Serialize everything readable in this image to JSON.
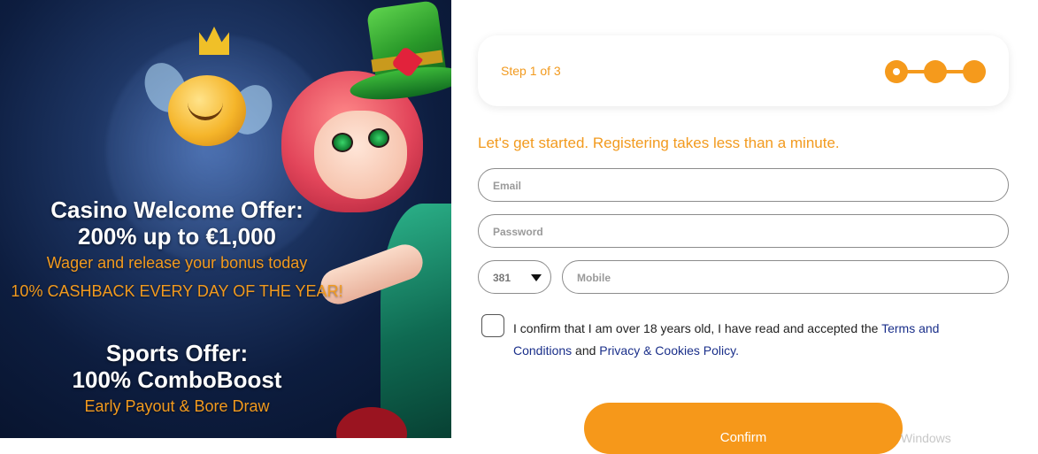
{
  "promo": {
    "casino_title_line1": "Casino Welcome Offer:",
    "casino_title_line2": "200% up to €1,000",
    "casino_sub1": "Wager and release your bonus today",
    "casino_sub2": "10% CASHBACK EVERY DAY OF THE YEAR!",
    "sports_title_line1": "Sports Offer:",
    "sports_title_line2": "100% ComboBoost",
    "sports_sub": "Early Payout & Bore Draw"
  },
  "steps": {
    "label": "Step 1 of 3",
    "current": 1,
    "total": 3
  },
  "form": {
    "intro": "Let's get started. Registering takes less than a minute.",
    "email_placeholder": "Email",
    "password_placeholder": "Password",
    "country_code": "381",
    "mobile_placeholder": "Mobile",
    "consent_prefix": "I confirm that I am over 18 years old, I have read and accepted the ",
    "terms_link": "Terms and Conditions",
    "consent_and": " and ",
    "privacy_link": "Privacy & Cookies Policy",
    "consent_suffix": ".",
    "confirm_label": "Confirm"
  },
  "watermark": "Windows",
  "colors": {
    "accent": "#f59a1c",
    "link": "#1a2f8a",
    "promo_bg": "#0d1d3f"
  }
}
